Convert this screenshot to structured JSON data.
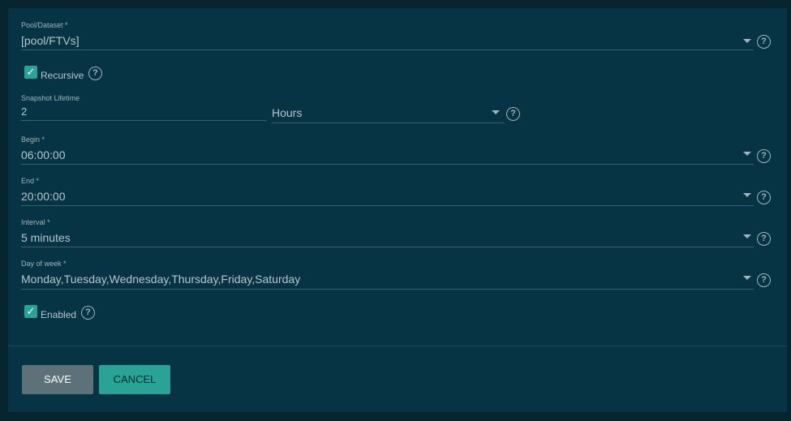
{
  "pool_dataset": {
    "label": "Pool/Dataset *",
    "value": "[pool/FTVs]"
  },
  "recursive": {
    "label": "Recursive",
    "checked": true
  },
  "snapshot_lifetime": {
    "label": "Snapshot Lifetime",
    "value": "2",
    "unit": "Hours"
  },
  "begin": {
    "label": "Begin *",
    "value": "06:00:00"
  },
  "end": {
    "label": "End *",
    "value": "20:00:00"
  },
  "interval": {
    "label": "Interval *",
    "value": "5 minutes"
  },
  "day_of_week": {
    "label": "Day of week *",
    "value": "Monday,Tuesday,Wednesday,Thursday,Friday,Saturday"
  },
  "enabled": {
    "label": "Enabled",
    "checked": true
  },
  "buttons": {
    "save": "SAVE",
    "cancel": "CANCEL"
  },
  "icons": {
    "help": "help-circle-icon",
    "dropdown": "chevron-down-icon",
    "check": "check-icon"
  },
  "colors": {
    "background": "#06252f",
    "card": "#063444",
    "accent": "#2aa397",
    "save_button": "#5d7179"
  }
}
